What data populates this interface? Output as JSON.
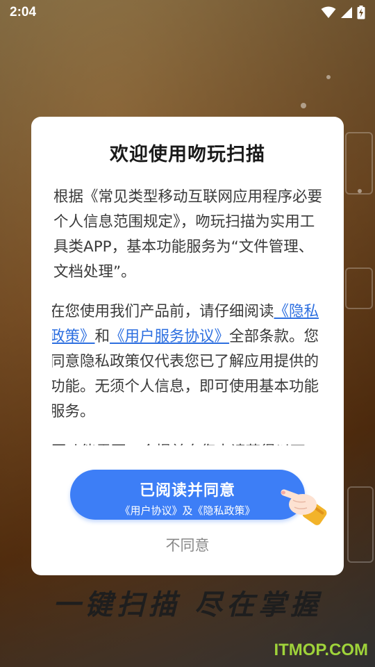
{
  "status": {
    "time": "2:04",
    "icons": [
      "wifi-icon",
      "signal-icon",
      "battery-charging-icon"
    ]
  },
  "background": {
    "slogan": "一键扫描  尽在掌握",
    "watermark": "ITMOP.COM"
  },
  "dialog": {
    "title": "欢迎使用吻玩扫描",
    "para1": "根据《常见类型移动互联网应用程序必要个人信息范围规定》，吻玩扫描为实用工具类APP，基本功能服务为“文件管理、文档处理”。",
    "para2_pre": "在您使用我们产品前，请仔细阅读",
    "privacy_link": "《隐私政策》",
    "para2_and": "和",
    "user_agreement_link": "《用户服务协议》",
    "para2_post": "全部条款。您同意隐私政策仅代表您已了解应用提供的功能。无须个人信息，即可使用基本功能服务。",
    "para3": "因功能需要，会提前向您申请获得以下",
    "agree_label": "已阅读并同意",
    "agree_sublabel": "《用户协议》及《隐私政策》",
    "disagree_label": "不同意"
  },
  "colors": {
    "accent": "#3d7ef6",
    "link": "#2d6fe0",
    "watermark": "#9fd33a"
  }
}
